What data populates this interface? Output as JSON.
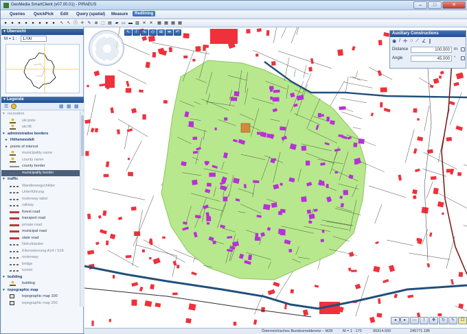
{
  "window": {
    "title": "GeoMedia SmartClient  (v07.00.01)  -  PIRAEUS",
    "minimize": "–",
    "maximize": "□",
    "close": "✕"
  },
  "menu": {
    "items": [
      {
        "label": "Queries",
        "active": false
      },
      {
        "label": "QuickPick",
        "active": false
      },
      {
        "label": "Edit",
        "active": false
      },
      {
        "label": "Query (spatial)",
        "active": false
      },
      {
        "label": "Measure",
        "active": false
      },
      {
        "label": "Redlining",
        "active": true
      }
    ]
  },
  "overview": {
    "header": "Übersicht",
    "scale_label": "M = 1 :",
    "scale_value": "1700"
  },
  "legend": {
    "header": "Legende",
    "rows": [
      {
        "label": "recreation",
        "kind": "group-open",
        "style": "greyed"
      },
      {
        "label": "ski piste",
        "kind": "item",
        "style": "greyed",
        "sym": "person"
      },
      {
        "label": "ski lift",
        "kind": "item",
        "style": "greyed",
        "sym": "person"
      },
      {
        "label": "administrative borders",
        "kind": "group",
        "style": "group"
      },
      {
        "label": "Höhenmodell",
        "kind": "sub",
        "style": "group"
      },
      {
        "label": "points of interest",
        "kind": "sub",
        "style": "normal"
      },
      {
        "label": "municipality name",
        "kind": "item",
        "style": "greyed",
        "sym": "person"
      },
      {
        "label": "county name",
        "kind": "item",
        "style": "greyed",
        "sym": "person"
      },
      {
        "label": "county border",
        "kind": "item",
        "style": "normal",
        "sym": "line-grey"
      },
      {
        "label": "municipality border",
        "kind": "item",
        "style": "selected",
        "sym": "line-dash"
      },
      {
        "label": "traffic",
        "kind": "group",
        "style": "group"
      },
      {
        "label": "Wanderwegschilder",
        "kind": "item",
        "style": "greyed",
        "sym": "line-dash"
      },
      {
        "label": "Unterführung",
        "kind": "item",
        "style": "greyed",
        "sym": "line-dash"
      },
      {
        "label": "motorway label",
        "kind": "item",
        "style": "greyed",
        "sym": "line-dash"
      },
      {
        "label": "railway",
        "kind": "item",
        "style": "greyed",
        "sym": "line-dash"
      },
      {
        "label": "forest road",
        "kind": "item",
        "style": "normal",
        "sym": "line-red"
      },
      {
        "label": "transport road",
        "kind": "item",
        "style": "normal",
        "sym": "line-red"
      },
      {
        "label": "private road",
        "kind": "item",
        "style": "greyed",
        "sym": "line-red"
      },
      {
        "label": "municipal road",
        "kind": "item",
        "style": "normal",
        "sym": "line-red"
      },
      {
        "label": "state road",
        "kind": "item",
        "style": "normal",
        "sym": "line-red"
      },
      {
        "label": "Notrufsäulen",
        "kind": "item",
        "style": "greyed",
        "sym": "line-dash"
      },
      {
        "label": "Kilometrierung A14 / S16",
        "kind": "item",
        "style": "greyed",
        "sym": "line-dash"
      },
      {
        "label": "motorway",
        "kind": "item",
        "style": "greyed",
        "sym": "line-dash"
      },
      {
        "label": "bridge",
        "kind": "item",
        "style": "greyed",
        "sym": "line-dash"
      },
      {
        "label": "tunnel",
        "kind": "item",
        "style": "greyed",
        "sym": "line-dash"
      },
      {
        "label": "building",
        "kind": "group",
        "style": "group"
      },
      {
        "label": "building",
        "kind": "item",
        "style": "normal",
        "sym": "person"
      },
      {
        "label": "topographic map",
        "kind": "group",
        "style": "group"
      },
      {
        "label": "topographic map 100",
        "kind": "item",
        "style": "normal",
        "sym": "box"
      },
      {
        "label": "topographic map 200",
        "kind": "item",
        "style": "greyed",
        "sym": "box"
      }
    ]
  },
  "aux": {
    "header": "Auxiliary Constructions",
    "distance_label": "Distance",
    "distance_value": "100.000",
    "distance_unit": "m",
    "angle_label": "Angle",
    "angle_value": "45.000",
    "angle_unit": "°"
  },
  "status": {
    "crs": "Österreichisches Bundesmeldenetz – M28",
    "scale": "M = 1 : 170",
    "x": "99314.030",
    "y": "245771.185"
  },
  "colors": {
    "buffer": "#b7e88d",
    "building_inside": "#b830d8",
    "building_outside": "#f0303a",
    "river": "#1f4f7a",
    "parcel": "#2b2b2b",
    "accent": "#2c5d9f"
  }
}
